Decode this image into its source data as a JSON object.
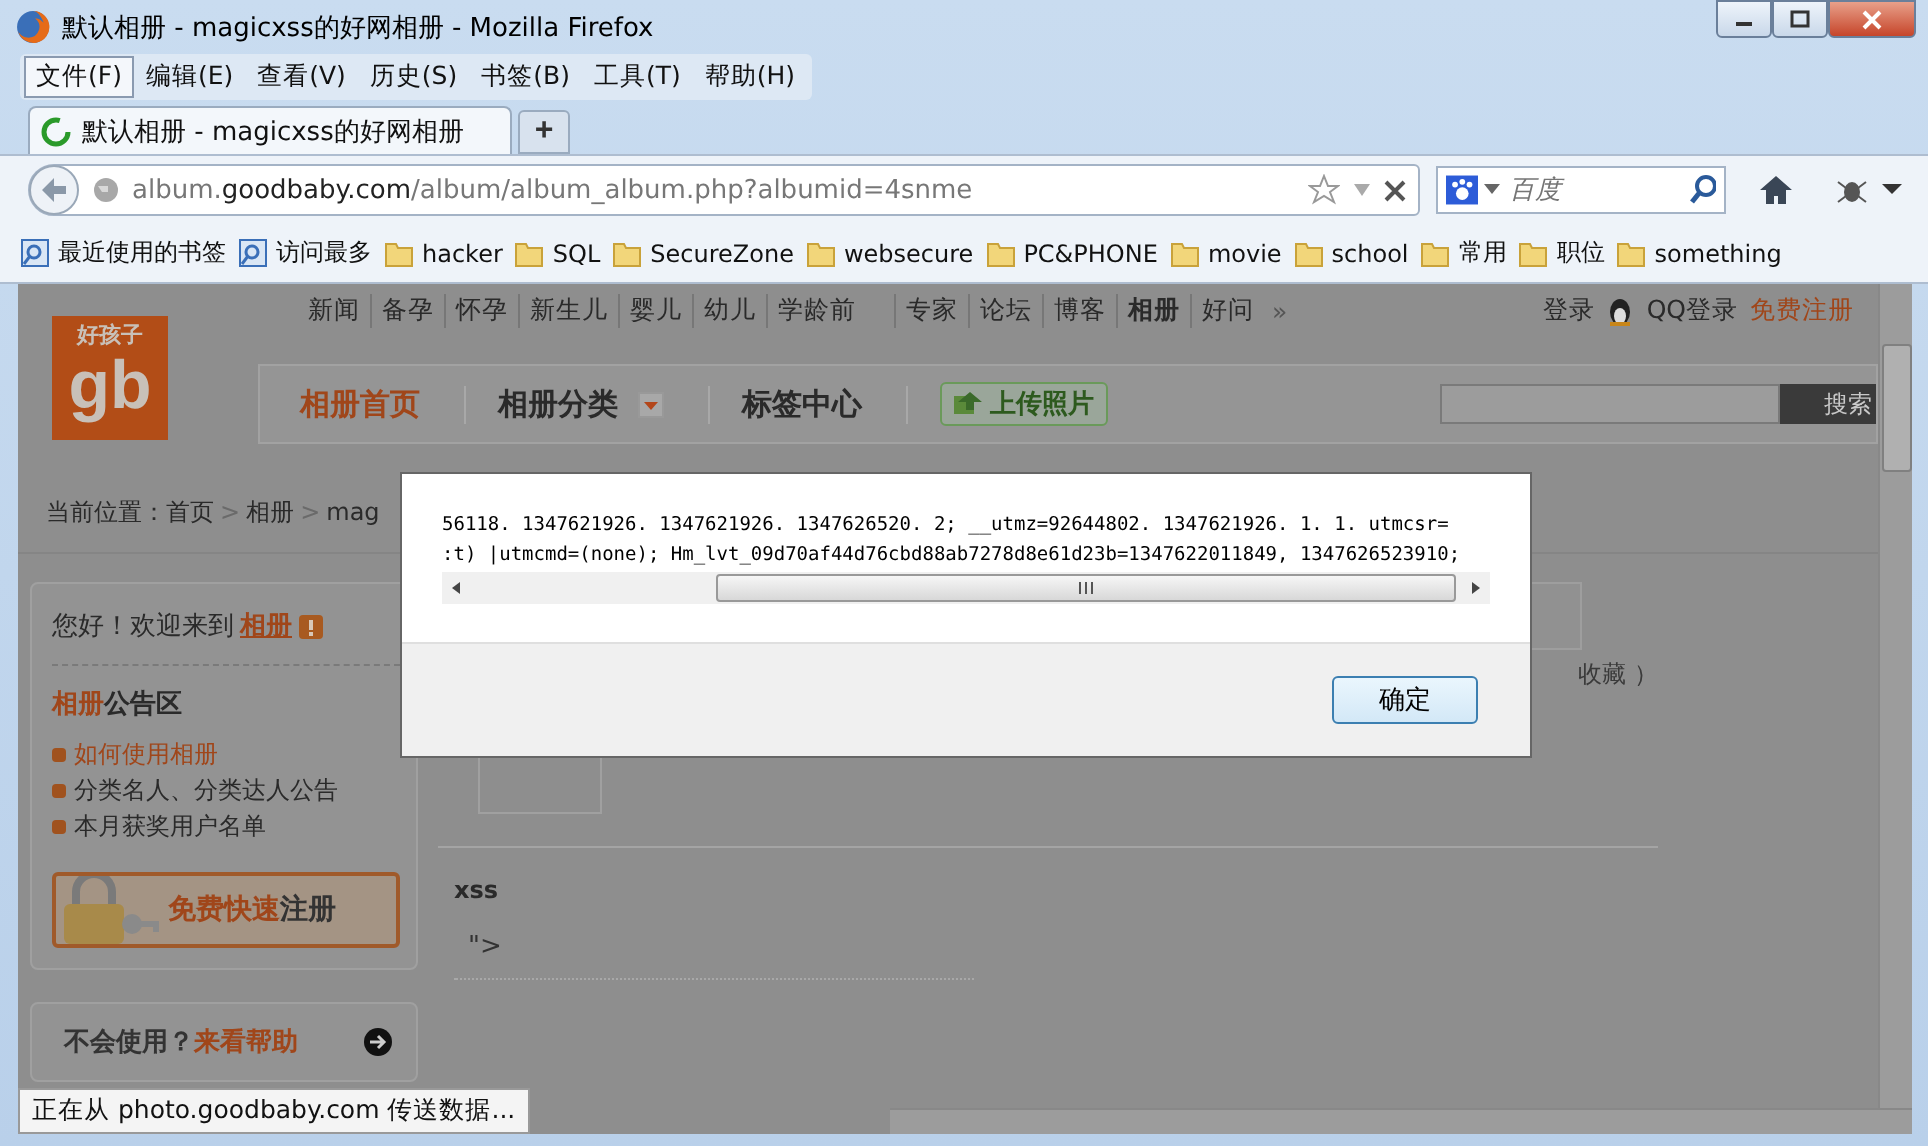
{
  "window": {
    "title": "默认相册 - magicxss的好网相册 - Mozilla Firefox"
  },
  "menu": [
    {
      "label": "文件(F)",
      "selected": true
    },
    {
      "label": "编辑(E)",
      "selected": false
    },
    {
      "label": "查看(V)",
      "selected": false
    },
    {
      "label": "历史(S)",
      "selected": false
    },
    {
      "label": "书签(B)",
      "selected": false
    },
    {
      "label": "工具(T)",
      "selected": false
    },
    {
      "label": "帮助(H)",
      "selected": false
    }
  ],
  "tabs": [
    {
      "label": "默认相册 - magicxss的好网相册",
      "selected": true
    }
  ],
  "new_tab": "+",
  "address": {
    "prefix": "album.",
    "domain": "goodbaby.com",
    "path": "/album/album_album.php?albumid=4snme"
  },
  "search": {
    "placeholder": "百度"
  },
  "bookmarks": [
    {
      "label": "最近使用的书签",
      "kind": "smart"
    },
    {
      "label": "访问最多",
      "kind": "smart"
    },
    {
      "label": "hacker",
      "kind": "folder"
    },
    {
      "label": "SQL",
      "kind": "folder"
    },
    {
      "label": "SecureZone",
      "kind": "folder"
    },
    {
      "label": "websecure",
      "kind": "folder"
    },
    {
      "label": "PC&PHONE",
      "kind": "folder"
    },
    {
      "label": "movie",
      "kind": "folder"
    },
    {
      "label": "school",
      "kind": "folder"
    },
    {
      "label": "常用",
      "kind": "folder"
    },
    {
      "label": "职位",
      "kind": "folder"
    },
    {
      "label": "something",
      "kind": "folder"
    }
  ],
  "page": {
    "site_nav": [
      {
        "label": "新闻",
        "strong": false
      },
      {
        "label": "备孕",
        "strong": false
      },
      {
        "label": "怀孕",
        "strong": false
      },
      {
        "label": "新生儿",
        "strong": false
      },
      {
        "label": "婴儿",
        "strong": false
      },
      {
        "label": "幼儿",
        "strong": false
      },
      {
        "label": "学龄前",
        "strong": false
      }
    ],
    "site_nav_2": [
      {
        "label": "专家",
        "strong": false
      },
      {
        "label": "论坛",
        "strong": false
      },
      {
        "label": "博客",
        "strong": false
      },
      {
        "label": "相册",
        "strong": true
      },
      {
        "label": "好问",
        "strong": false
      }
    ],
    "more": "»",
    "login": "登录",
    "qq_login": "QQ登录",
    "register": "免费注册",
    "logo": {
      "tagline": "好孩子",
      "mark": "gb"
    },
    "site_tabs": [
      {
        "label": "相册首页",
        "selected": true,
        "dropdown": false
      },
      {
        "label": "相册分类",
        "selected": false,
        "dropdown": true
      },
      {
        "label": "标签中心",
        "selected": false,
        "dropdown": false
      }
    ],
    "upload_button": "上传照片",
    "search_button": "搜索",
    "breadcrumb": [
      "当前位置：首页",
      ">",
      "相册",
      ">",
      "mag"
    ],
    "greeting": {
      "text": "您好！欢迎来到",
      "link": "相册"
    },
    "notice_title": {
      "highlight": "相册",
      "rest": "公告区"
    },
    "notices": [
      {
        "label": "如何使用相册",
        "kind": "link"
      },
      {
        "label": "分类名人、分类达人公告",
        "kind": "text"
      },
      {
        "label": "本月获奖用户名单",
        "kind": "text"
      }
    ],
    "register_button": {
      "highlight": "免费快速",
      "rest": "注册"
    },
    "help": {
      "text": "不会使用？",
      "link": "来看帮助"
    },
    "favorite_text": "收藏 ）",
    "section_title": "xss",
    "comment": "\">"
  },
  "dialog": {
    "lines": [
      "56118. 1347621926. 1347621926. 1347626520. 2;  __utmz=92644802. 1347621926. 1. 1. utmcsr=",
      ":t) |utmcmd=(none);  Hm_lvt_09d70af44d76cbd88ab7278d8e61d23b=1347622011849, 1347626523910;"
    ],
    "ok_button": "确定"
  },
  "status_bar": "正在从 photo.goodbaby.com 传送数据..."
}
